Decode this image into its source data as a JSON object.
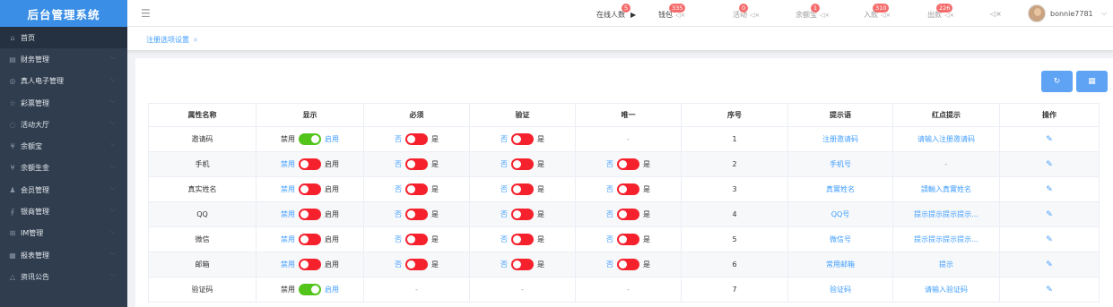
{
  "app_title": "后台管理系统",
  "sidebar": {
    "items": [
      {
        "label": "首页",
        "icon": "home-icon",
        "glyph": "⌂"
      },
      {
        "label": "财务管理",
        "icon": "finance-icon",
        "glyph": "▤"
      },
      {
        "label": "真人电子管理",
        "icon": "live-casino-icon",
        "glyph": "◎"
      },
      {
        "label": "彩票管理",
        "icon": "star-icon",
        "glyph": "☆"
      },
      {
        "label": "活动大厅",
        "icon": "activity-icon",
        "glyph": "◌"
      },
      {
        "label": "余额宝",
        "icon": "yuebao-icon",
        "glyph": "¥"
      },
      {
        "label": "余额生金",
        "icon": "yield-icon",
        "glyph": "¥"
      },
      {
        "label": "会员管理",
        "icon": "member-icon",
        "glyph": "♟"
      },
      {
        "label": "银商管理",
        "icon": "merchant-icon",
        "glyph": "∮"
      },
      {
        "label": "IM管理",
        "icon": "im-icon",
        "glyph": "⊞"
      },
      {
        "label": "报表管理",
        "icon": "report-icon",
        "glyph": "▦"
      },
      {
        "label": "资讯公告",
        "icon": "bell-icon",
        "glyph": "△"
      }
    ]
  },
  "topbar": {
    "online": {
      "label": "在线人数",
      "badge": "5"
    },
    "wallet": {
      "label": "钱包",
      "badge": "335"
    },
    "activity": {
      "label": "活动",
      "badge": "0"
    },
    "yuebao": {
      "label": "余额宝",
      "badge": "1"
    },
    "deposit": {
      "label": "入款",
      "badge": "310"
    },
    "withdraw": {
      "label": "出款",
      "badge": "226"
    },
    "username": "bonnie7781"
  },
  "tab": {
    "label": "注册选项设置"
  },
  "table": {
    "headers": [
      "属性名称",
      "显示",
      "必须",
      "验证",
      "唯一",
      "序号",
      "提示语",
      "红点提示",
      "操作"
    ],
    "off_label": "禁用",
    "on_label": "启用",
    "no_label": "否",
    "yes_label": "是",
    "dash": "-",
    "rows": [
      {
        "name": "邀请码",
        "display": "on",
        "required": "off",
        "verify": "off",
        "unique": null,
        "order": "1",
        "hint": "注册邀请码",
        "red_hint": "请输入注册邀请码"
      },
      {
        "name": "手机",
        "display": "off",
        "required": "off",
        "verify": "off",
        "unique": "off",
        "order": "2",
        "hint": "手机号",
        "red_hint": "-"
      },
      {
        "name": "真实姓名",
        "display": "off",
        "required": "off",
        "verify": "off",
        "unique": "off",
        "order": "3",
        "hint": "真實姓名",
        "red_hint": "請輸入真實姓名"
      },
      {
        "name": "QQ",
        "display": "off",
        "required": "off",
        "verify": "off",
        "unique": "off",
        "order": "4",
        "hint": "QQ号",
        "red_hint": "提示提示提示提示..."
      },
      {
        "name": "微信",
        "display": "off",
        "required": "off",
        "verify": "off",
        "unique": "off",
        "order": "5",
        "hint": "微信号",
        "red_hint": "提示提示提示提示..."
      },
      {
        "name": "邮箱",
        "display": "off",
        "required": "off",
        "verify": "off",
        "unique": "off",
        "order": "6",
        "hint": "常用邮箱",
        "red_hint": "提示"
      },
      {
        "name": "验证码",
        "display": "on",
        "required": null,
        "verify": null,
        "unique": null,
        "order": "7",
        "hint": "验证码",
        "red_hint": "请输入验证码"
      }
    ]
  },
  "colors": {
    "sidebar_bg": "#2f3d4e",
    "logo_bg": "#3a8ee6",
    "switch_on": "#52c41a",
    "switch_off": "#f5222d",
    "link": "#409eff"
  }
}
